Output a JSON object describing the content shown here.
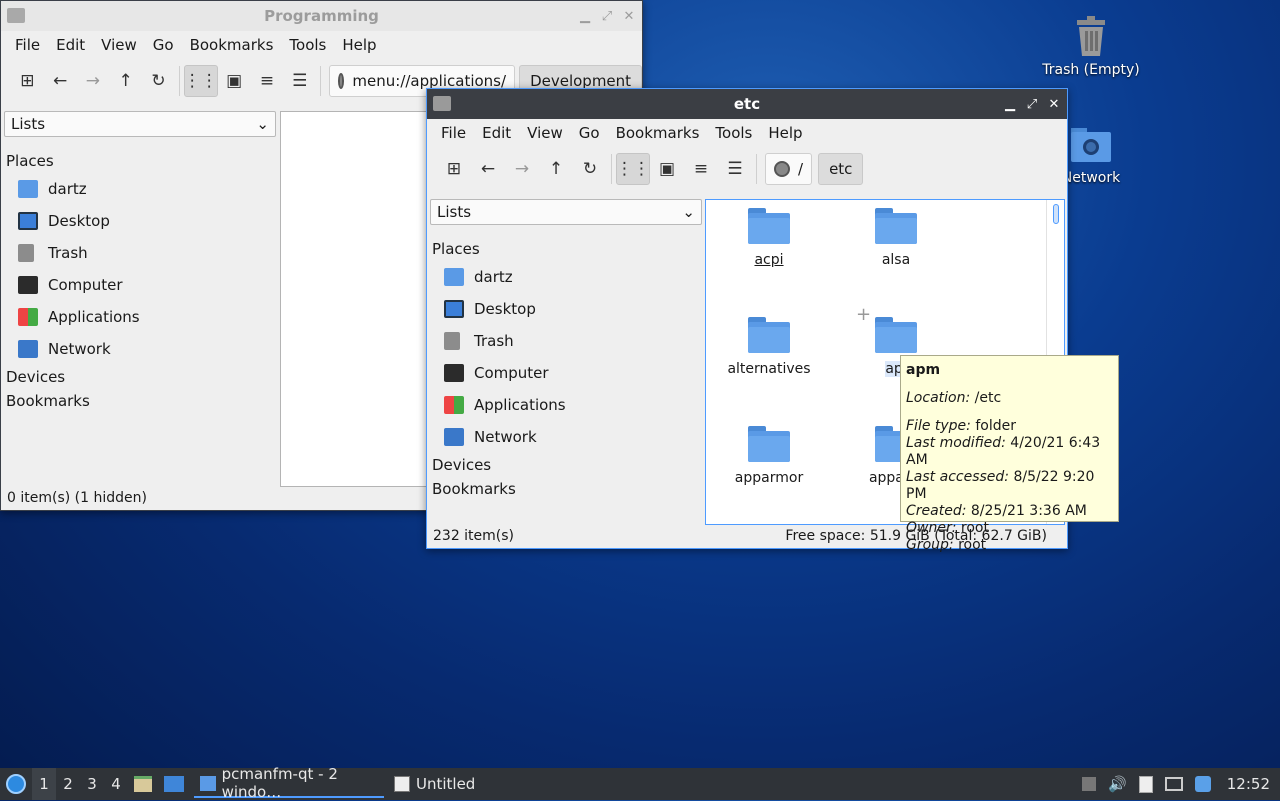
{
  "desktop": {
    "trash_label": "Trash (Empty)",
    "network_label": "Network"
  },
  "win_programming": {
    "title": "Programming",
    "menus": [
      "File",
      "Edit",
      "View",
      "Go",
      "Bookmarks",
      "Tools",
      "Help"
    ],
    "path": "menu://applications/",
    "path_button": "Development",
    "side_select": "Lists",
    "places_header": "Places",
    "places": [
      "dartz",
      "Desktop",
      "Trash",
      "Computer",
      "Applications",
      "Network"
    ],
    "devices_header": "Devices",
    "bookmarks_header": "Bookmarks",
    "status_left": "0 item(s) (1 hidden)"
  },
  "win_etc": {
    "title": "etc",
    "menus": [
      "File",
      "Edit",
      "View",
      "Go",
      "Bookmarks",
      "Tools",
      "Help"
    ],
    "path_root": "/",
    "path_button": "etc",
    "side_select": "Lists",
    "places_header": "Places",
    "places": [
      "dartz",
      "Desktop",
      "Trash",
      "Computer",
      "Applications",
      "Network"
    ],
    "devices_header": "Devices",
    "bookmarks_header": "Bookmarks",
    "folders": [
      "acpi",
      "alsa",
      "alternatives",
      "apm",
      "apparmor",
      "apparm"
    ],
    "folder_apm_short": "apı",
    "status_left": "232 item(s)",
    "status_right": "Free space: 51.9 GiB (Total: 62.7 GiB)"
  },
  "tooltip": {
    "name": "apm",
    "location_label": "Location:",
    "location_value": " /etc",
    "type_label": "File type:",
    "type_value": " folder",
    "modified_label": "Last modified:",
    "modified_value": " 4/20/21 6:43 AM",
    "accessed_label": "Last accessed:",
    "accessed_value": " 8/5/22 9:20 PM",
    "created_label": "Created:",
    "created_value": " 8/25/21 3:36 AM",
    "owner_label": "Owner:",
    "owner_value": " root",
    "group_label": "Group:",
    "group_value": " root"
  },
  "taskbar": {
    "workspaces": [
      "1",
      "2",
      "3",
      "4"
    ],
    "task_fm": "pcmanfm-qt - 2 windo…",
    "task_editor": "Untitled",
    "clock": "12:52"
  },
  "colors": {
    "accent": "#4e9bff",
    "folder": "#5a9ae6",
    "tooltip_bg": "#ffffdc"
  }
}
